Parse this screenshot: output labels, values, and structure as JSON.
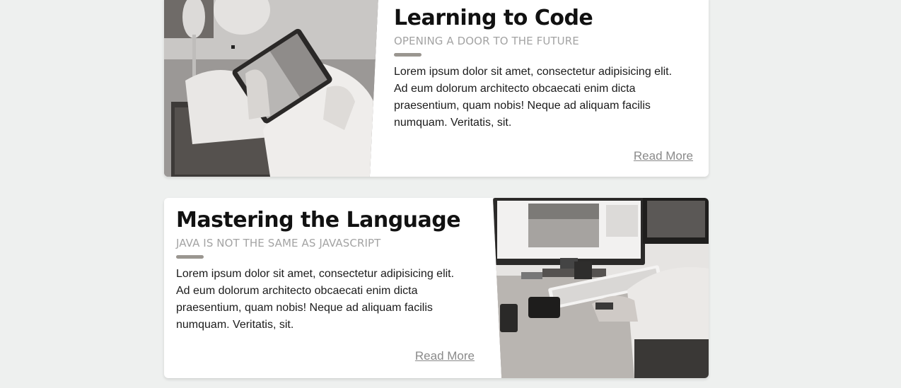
{
  "cards": [
    {
      "title": "Learning to Code",
      "subtitle": "Opening a door to the future",
      "body": "Lorem ipsum dolor sit amet, consectetur adipisicing elit. Ad eum dolorum architecto obcaecati enim dicta praesentium, quam nobis! Neque ad aliquam facilis numquam. Veritatis, sit.",
      "read_more": "Read More",
      "image": "photo-hands-holding-tablet"
    },
    {
      "title": "Mastering the Language",
      "subtitle": "Java is not the same as JavaScript",
      "body": "Lorem ipsum dolor sit amet, consectetur adipisicing elit. Ad eum dolorum architecto obcaecati enim dicta praesentium, quam nobis! Neque ad aliquam facilis numquam. Veritatis, sit.",
      "read_more": "Read More",
      "image": "photo-desk-with-monitor-and-keyboard"
    }
  ],
  "colors": {
    "background": "#eef0ef",
    "card": "#ffffff",
    "accent_bar": "#9a9690",
    "subtitle": "#a3a3a3",
    "link": "#8a8a8a"
  }
}
